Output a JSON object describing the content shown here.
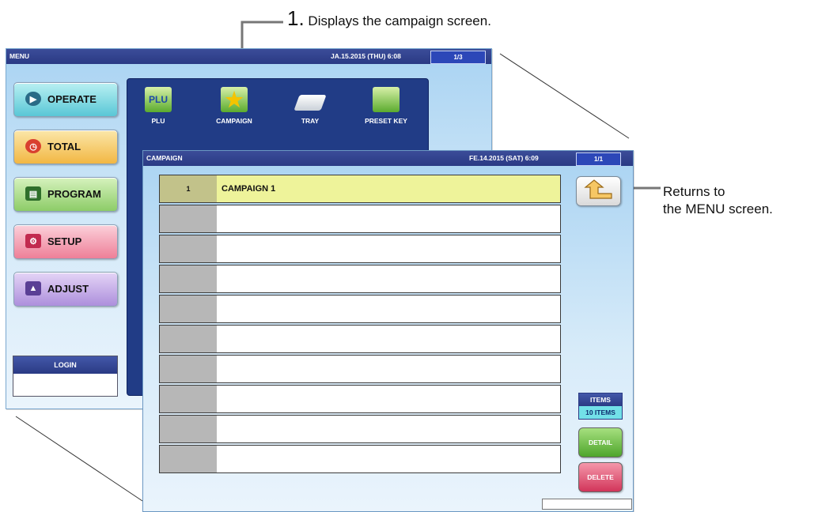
{
  "annotations": {
    "step_number": "1.",
    "step_text": "Displays the campaign screen.",
    "return_line1": "Returns to",
    "return_line2": "the MENU screen."
  },
  "menu_screen": {
    "title": "MENU",
    "datetime": "JA.15.2015 (THU)  6:08",
    "page": "1/3",
    "buttons": [
      {
        "label": "OPERATE"
      },
      {
        "label": "TOTAL"
      },
      {
        "label": "PROGRAM"
      },
      {
        "label": "SETUP"
      },
      {
        "label": "ADJUST"
      }
    ],
    "icons": [
      {
        "label": "PLU"
      },
      {
        "label": "CAMPAIGN"
      },
      {
        "label": "TRAY"
      },
      {
        "label": "PRESET KEY"
      }
    ],
    "login": "LOGIN"
  },
  "campaign_screen": {
    "title": "CAMPAIGN",
    "datetime": "FE.14.2015 (SAT)  6:09",
    "page": "1/1",
    "rows": [
      {
        "number": "1",
        "name": "CAMPAIGN 1"
      },
      {
        "number": "",
        "name": ""
      },
      {
        "number": "",
        "name": ""
      },
      {
        "number": "",
        "name": ""
      },
      {
        "number": "",
        "name": ""
      },
      {
        "number": "",
        "name": ""
      },
      {
        "number": "",
        "name": ""
      },
      {
        "number": "",
        "name": ""
      },
      {
        "number": "",
        "name": ""
      },
      {
        "number": "",
        "name": ""
      }
    ],
    "items_label": "ITEMS",
    "items_value": "10 ITEMS",
    "detail_label": "DETAIL",
    "delete_label": "DELETE"
  },
  "colors": {
    "titlebar": "#2a3a84",
    "highlight_row": "#eef39a",
    "detail": "#4ea52b",
    "delete": "#d2355a"
  }
}
